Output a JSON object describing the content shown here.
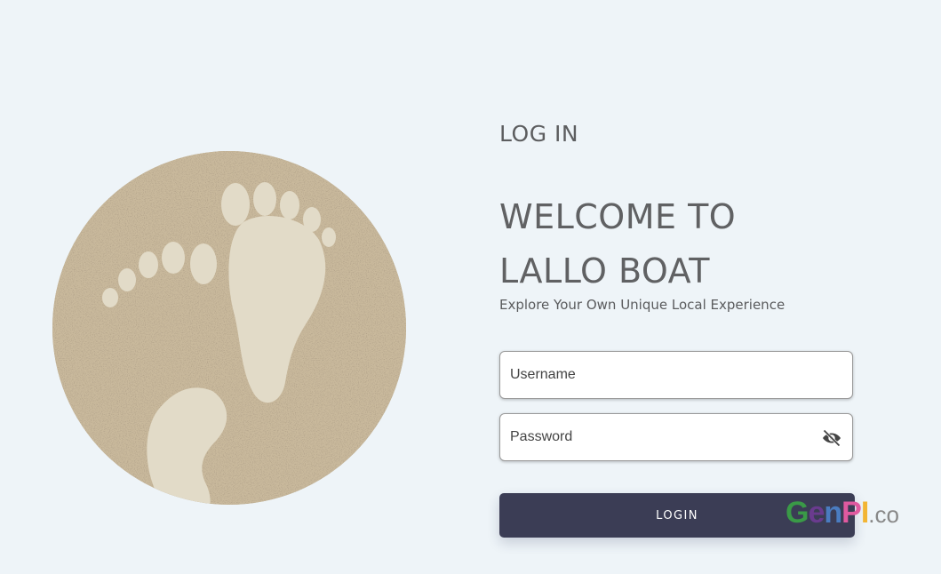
{
  "hero": {
    "image": "sand-footprints-illustration"
  },
  "form": {
    "kicker": "LOG IN",
    "welcome_line1": "WELCOME TO",
    "welcome_line2": "LALLO BOAT",
    "tagline": "Explore Your Own Unique Local Experience",
    "username": {
      "placeholder": "Username",
      "value": ""
    },
    "password": {
      "placeholder": "Password",
      "value": "",
      "toggle_icon": "eye-off-icon"
    },
    "login_button": "LOGIN"
  },
  "watermark": {
    "g": "G",
    "e": "e",
    "n": "n",
    "p": "P",
    "i": "I",
    "co": ".co"
  },
  "colors": {
    "background": "#eef4f8",
    "button": "#3b3d55",
    "text": "#5f6062"
  }
}
